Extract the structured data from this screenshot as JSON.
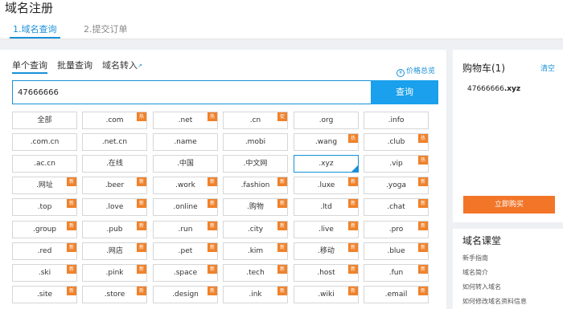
{
  "header": {
    "title": "域名注册",
    "steps": [
      {
        "label": "1.域名查询",
        "active": true
      },
      {
        "label": "2.提交订单",
        "active": false
      }
    ]
  },
  "search": {
    "tabs": [
      {
        "label": "单个查询",
        "active": true
      },
      {
        "label": "批量查询",
        "active": false
      },
      {
        "label": "域名转入",
        "active": false
      }
    ],
    "price_link": "价格总览",
    "input_value": "47666666",
    "button_label": "查询"
  },
  "suffixes": [
    {
      "label": "全部"
    },
    {
      "label": ".com",
      "badge": "热"
    },
    {
      "label": ".net",
      "badge": "热"
    },
    {
      "label": ".cn",
      "badge": "促"
    },
    {
      "label": ".org"
    },
    {
      "label": ".info"
    },
    {
      "label": ".com.cn"
    },
    {
      "label": ".net.cn"
    },
    {
      "label": ".name"
    },
    {
      "label": ".mobi"
    },
    {
      "label": ".wang",
      "badge": "热"
    },
    {
      "label": ".club",
      "badge": "热"
    },
    {
      "label": ".ac.cn"
    },
    {
      "label": ".在线"
    },
    {
      "label": ".中国"
    },
    {
      "label": ".中文网"
    },
    {
      "label": ".xyz",
      "selected": true
    },
    {
      "label": ".vip",
      "badge": "热"
    },
    {
      "label": ".网址",
      "badge": "新"
    },
    {
      "label": ".beer",
      "badge": "新"
    },
    {
      "label": ".work",
      "badge": "新"
    },
    {
      "label": ".fashion",
      "badge": "新"
    },
    {
      "label": ".luxe",
      "badge": "新"
    },
    {
      "label": ".yoga",
      "badge": "新"
    },
    {
      "label": ".top",
      "badge": "新"
    },
    {
      "label": ".love",
      "badge": "新"
    },
    {
      "label": ".online",
      "badge": "新"
    },
    {
      "label": ".购物",
      "badge": "新"
    },
    {
      "label": ".ltd",
      "badge": "新"
    },
    {
      "label": ".chat",
      "badge": "新"
    },
    {
      "label": ".group",
      "badge": "新"
    },
    {
      "label": ".pub",
      "badge": "新"
    },
    {
      "label": ".run",
      "badge": "新"
    },
    {
      "label": ".city",
      "badge": "新"
    },
    {
      "label": ".live",
      "badge": "新"
    },
    {
      "label": ".pro",
      "badge": "新"
    },
    {
      "label": ".red",
      "badge": "新"
    },
    {
      "label": ".网店",
      "badge": "新"
    },
    {
      "label": ".pet",
      "badge": "新"
    },
    {
      "label": ".kim",
      "badge": "新"
    },
    {
      "label": ".移动",
      "badge": "新"
    },
    {
      "label": ".blue",
      "badge": "新"
    },
    {
      "label": ".ski",
      "badge": "新"
    },
    {
      "label": ".pink",
      "badge": "新"
    },
    {
      "label": ".space",
      "badge": "新"
    },
    {
      "label": ".tech",
      "badge": "新"
    },
    {
      "label": ".host",
      "badge": "新"
    },
    {
      "label": ".fun",
      "badge": "新"
    },
    {
      "label": ".site",
      "badge": "新"
    },
    {
      "label": ".store",
      "badge": "新"
    },
    {
      "label": ".design",
      "badge": "新"
    },
    {
      "label": ".ink",
      "badge": "新"
    },
    {
      "label": ".wiki",
      "badge": "新"
    },
    {
      "label": ".email",
      "badge": "新"
    }
  ],
  "cart": {
    "title": "购物车(1)",
    "clear_label": "清空",
    "item_prefix": "47666666",
    "item_suffix": ".xyz",
    "buy_label": "立即购买"
  },
  "course": {
    "title": "域名课堂",
    "links": [
      "新手指南",
      "域名简介",
      "如何转入域名",
      "如何修改域名资料信息"
    ]
  },
  "colors": {
    "accent": "#1890d8",
    "badge": "#f0822b",
    "buy": "#f27528"
  }
}
